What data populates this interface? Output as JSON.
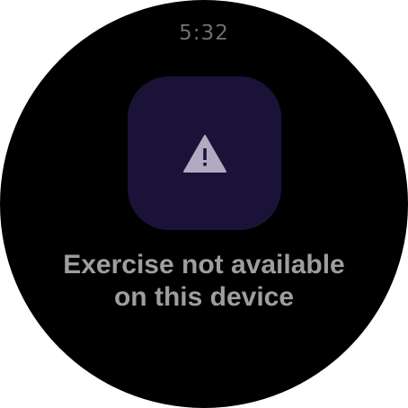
{
  "status_bar": {
    "time": "5:32"
  },
  "alert": {
    "icon": "warning-icon",
    "tile_color": "#1b1238",
    "icon_color": "#b3a9c2",
    "message_line1": "Exercise not available",
    "message_line2": "on this device"
  }
}
